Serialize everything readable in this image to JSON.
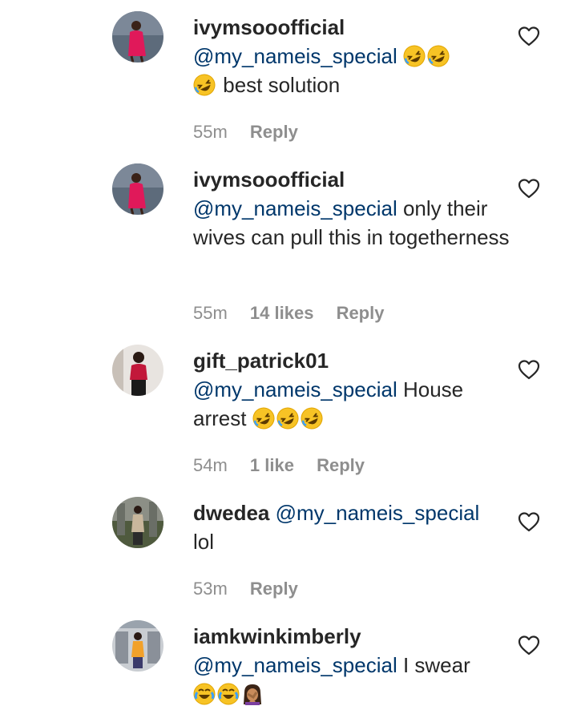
{
  "comments": [
    {
      "username": "ivymsooofficial",
      "mention": "@my_nameis_special",
      "text_after_emojis": "best solution",
      "emojis": [
        "rofl-emoji",
        "rofl-emoji",
        "rofl-emoji"
      ],
      "time": "55m",
      "reply": "Reply"
    },
    {
      "username": "ivymsooofficial",
      "mention": "@my_nameis_special",
      "text": "only their wives can pull this in togetherness",
      "time": "55m",
      "likes": "14 likes",
      "reply": "Reply"
    },
    {
      "username": "gift_patrick01",
      "mention": "@my_nameis_special",
      "text": "House arrest",
      "emojis": [
        "rofl-emoji",
        "rofl-emoji",
        "rofl-emoji"
      ],
      "time": "54m",
      "likes": "1 like",
      "reply": "Reply"
    },
    {
      "username": "dwedea",
      "mention": "@my_nameis_special",
      "text": "lol",
      "time": "53m",
      "reply": "Reply"
    },
    {
      "username": "iamkwinkimberly",
      "mention": "@my_nameis_special",
      "text": "I swear",
      "emojis": [
        "tears-of-joy-emoji",
        "tears-of-joy-emoji",
        "facepalm-emoji"
      ]
    }
  ]
}
